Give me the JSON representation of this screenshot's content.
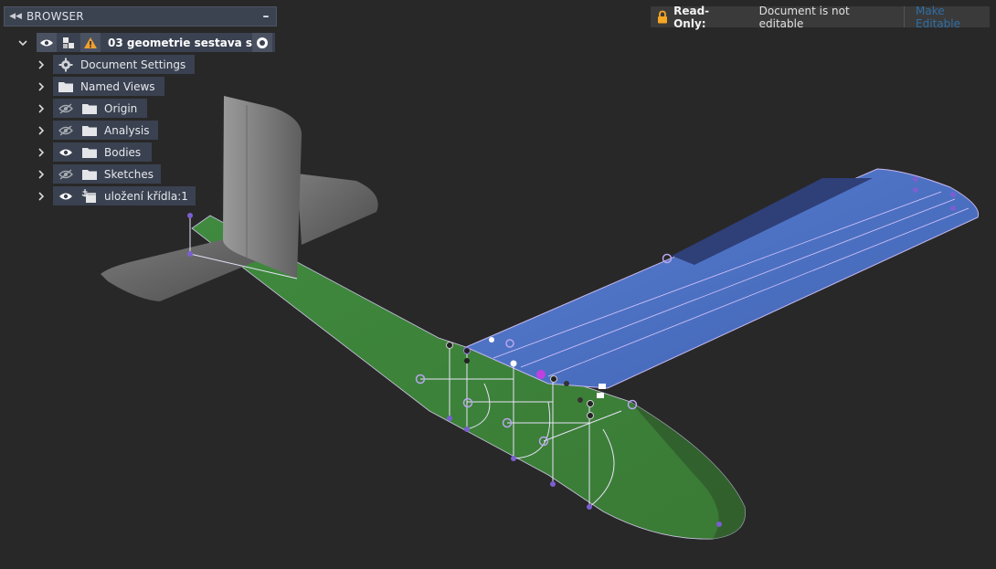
{
  "browser": {
    "title": "BROWSER",
    "collapse_icon": "double-chevron-left-icon",
    "minimize_icon": "minus-icon",
    "root": {
      "label": "03 geometrie sestava s...",
      "icons": [
        "chevron-down-icon",
        "eye-icon",
        "component-icon",
        "warning-icon",
        "radio-button-icon"
      ]
    },
    "items": [
      {
        "label": "Document Settings",
        "icons": [
          "gear-icon"
        ]
      },
      {
        "label": "Named Views",
        "icons": [
          "folder-icon"
        ]
      },
      {
        "label": "Origin",
        "icons": [
          "eye-hidden-icon",
          "folder-icon"
        ]
      },
      {
        "label": "Analysis",
        "icons": [
          "eye-hidden-icon",
          "folder-icon"
        ]
      },
      {
        "label": "Bodies",
        "icons": [
          "eye-icon",
          "folder-icon"
        ]
      },
      {
        "label": "Sketches",
        "icons": [
          "eye-hidden-icon",
          "folder-icon"
        ]
      },
      {
        "label": "uložení křídla:1",
        "icons": [
          "eye-icon",
          "anchored-component-icon"
        ]
      }
    ]
  },
  "readonly_banner": {
    "label": "Read-Only:",
    "message": "Document is not editable",
    "action": "Make Editable",
    "accent_color": "#f5a623",
    "link_color": "#2f6fa6"
  },
  "viewport": {
    "wing_color": "#4a6fc0",
    "fuselage_color": "#3f7a3a",
    "tail_color": "#8a8a8a"
  }
}
